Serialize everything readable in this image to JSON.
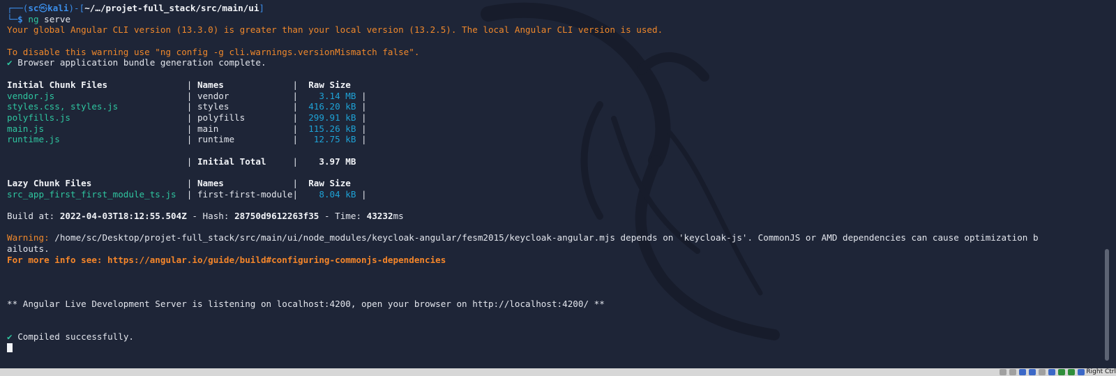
{
  "terminal": {
    "prompt": {
      "open": "┌──(",
      "user": "sc",
      "at": "㉿",
      "host": "kali",
      "mid": ")-[",
      "path": "~/…/projet-full_stack/src/main/ui",
      "close": "]",
      "second_line": "└─",
      "dollar": "$",
      "command": "ng",
      "command_args": "serve"
    },
    "version_warning": "Your global Angular CLI version (13.3.0) is greater than your local version (13.2.5). The local Angular CLI version is used.",
    "disable_hint": "To disable this warning use \"ng config -g cli.warnings.versionMismatch false\".",
    "check_mark": "✔",
    "bundle_complete": "Browser application bundle generation complete.",
    "initial_header": {
      "files": "Initial Chunk Files",
      "names": "Names",
      "size": "Raw Size"
    },
    "initial_rows": [
      {
        "file": "vendor.js",
        "name": "vendor",
        "size": "3.14 MB"
      },
      {
        "file": "styles.css, styles.js",
        "name": "styles",
        "size": "416.20 kB"
      },
      {
        "file": "polyfills.js",
        "name": "polyfills",
        "size": "299.91 kB"
      },
      {
        "file": "main.js",
        "name": "main",
        "size": "115.26 kB"
      },
      {
        "file": "runtime.js",
        "name": "runtime",
        "size": "12.75 kB"
      }
    ],
    "initial_total": {
      "label": "Initial Total",
      "size": "3.97 MB"
    },
    "lazy_header": {
      "files": "Lazy Chunk Files",
      "names": "Names",
      "size": "Raw Size"
    },
    "lazy_rows": [
      {
        "file": "src_app_first_first_module_ts.js",
        "name": "first-first-module",
        "size": "8.04 kB"
      }
    ],
    "build": {
      "at_label": "Build at: ",
      "at": "2022-04-03T18:12:55.504Z",
      "hash_label": " - Hash: ",
      "hash": "28750d9612263f35",
      "time_label": " - Time: ",
      "time": "43232",
      "time_unit": "ms"
    },
    "warning_label": "Warning:",
    "warning_text_1": " /home/sc/Desktop/projet-full_stack/src/main/ui/node_modules/keycloak-angular/fesm2015/keycloak-angular.mjs depends on 'keycloak-js'. CommonJS or AMD dependencies can cause optimization b",
    "warning_text_2": "ailouts.",
    "more_info": "For more info see: https://angular.io/guide/build#configuring-commonjs-dependencies",
    "server_listening": "** Angular Live Development Server is listening on localhost:4200, open your browser on http://localhost:4200/ **",
    "compiled": "Compiled successfully."
  },
  "statusbar": {
    "right_ctrl": "Right Ctrl"
  },
  "colors": {
    "background": "#1e2537",
    "prompt_blue": "#3b8eea",
    "file_green": "#2fc6a0",
    "size_cyan": "#1ea2d6",
    "warning_orange": "#f0882b"
  }
}
